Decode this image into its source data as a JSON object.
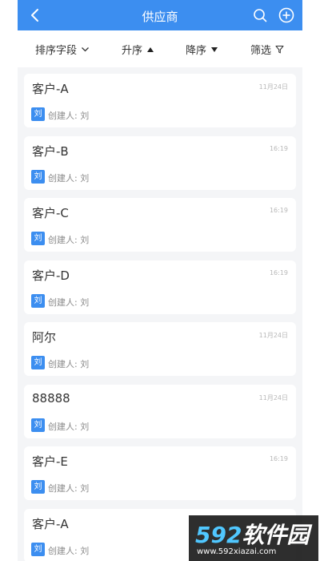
{
  "header": {
    "title": "供应商",
    "back_icon": "chevron-left-icon",
    "search_icon": "search-icon",
    "add_icon": "plus-circle-icon"
  },
  "toolbar": {
    "sort_field_label": "排序字段",
    "ascending_label": "升序",
    "descending_label": "降序",
    "filter_label": "筛选"
  },
  "colors": {
    "accent": "#3c8ef0",
    "background": "#f4f5f7",
    "card": "#ffffff",
    "muted": "#8a8a8a"
  },
  "items": [
    {
      "name": "客户-A",
      "time": "11月24日",
      "avatar": "刘",
      "creator": "创建人: 刘"
    },
    {
      "name": "客户-B",
      "time": "16:19",
      "avatar": "刘",
      "creator": "创建人: 刘"
    },
    {
      "name": "客户-C",
      "time": "16:19",
      "avatar": "刘",
      "creator": "创建人: 刘"
    },
    {
      "name": "客户-D",
      "time": "16:19",
      "avatar": "刘",
      "creator": "创建人: 刘"
    },
    {
      "name": "阿尔",
      "time": "11月24日",
      "avatar": "刘",
      "creator": "创建人: 刘"
    },
    {
      "name": "88888",
      "time": "11月24日",
      "avatar": "刘",
      "creator": "创建人: 刘"
    },
    {
      "name": "客户-E",
      "time": "16:19",
      "avatar": "刘",
      "creator": "创建人: 刘"
    },
    {
      "name": "客户-A",
      "time": "",
      "avatar": "刘",
      "creator": "创建人: 刘"
    }
  ],
  "watermark": {
    "logo_digits": "592",
    "logo_text": "软件园",
    "url": "www.592xiazai.com"
  }
}
